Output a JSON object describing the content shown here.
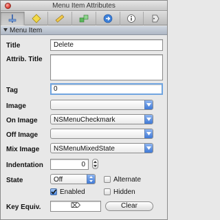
{
  "window": {
    "title": "Menu Item Attributes"
  },
  "toolbar": {
    "tabs": [
      {
        "icon": "attributes-slider-icon"
      },
      {
        "icon": "connections-diamond-icon"
      },
      {
        "icon": "ruler-icon"
      },
      {
        "icon": "bindings-boxes-icon"
      },
      {
        "icon": "arrow-circle-icon"
      },
      {
        "icon": "info-icon"
      },
      {
        "icon": "identity-tag-icon"
      }
    ],
    "selected_index": 0
  },
  "section": {
    "title": "Menu Item"
  },
  "form": {
    "title_label": "Title",
    "title_value": "Delete",
    "attrib_title_label": "Attrib. Title",
    "attrib_title_value": "",
    "tag_label": "Tag",
    "tag_value": "0",
    "image_label": "Image",
    "image_value": "",
    "on_image_label": "On Image",
    "on_image_value": "NSMenuCheckmark",
    "off_image_label": "Off Image",
    "off_image_value": "",
    "mix_image_label": "Mix Image",
    "mix_image_value": "NSMenuMixedState",
    "indentation_label": "Indentation",
    "indentation_value": "0",
    "state_label": "State",
    "state_value": "Off",
    "alternate_label": "Alternate",
    "alternate_checked": false,
    "enabled_label": "Enabled",
    "enabled_checked": true,
    "hidden_label": "Hidden",
    "hidden_checked": false,
    "key_equiv_label": "Key Equiv.",
    "key_equiv_symbol": "⌦",
    "clear_label": "Clear"
  },
  "colors": {
    "focus_ring": "#6fa4e0",
    "popup_accent": "#3f79d6",
    "close_button": "#e0443a"
  }
}
